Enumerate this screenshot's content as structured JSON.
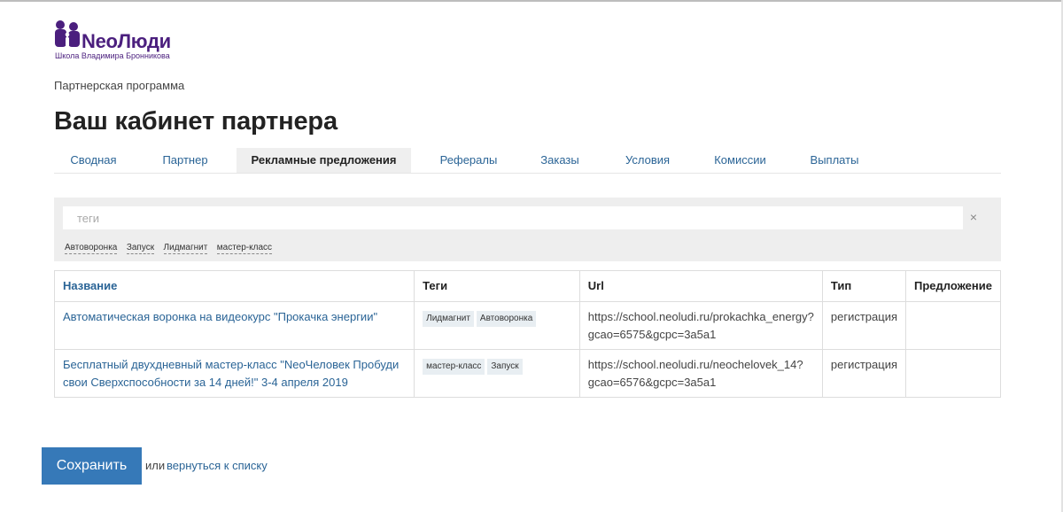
{
  "logo": {
    "brand": "NeoЛюди",
    "subtitle": "Школа Владимира Бронникова",
    "color": "#4b1f7e"
  },
  "breadcrumb": "Партнерская программа",
  "page_title": "Ваш кабинет партнера",
  "tabs": [
    {
      "label": "Сводная",
      "active": false
    },
    {
      "label": "Партнер",
      "active": false
    },
    {
      "label": "Рекламные предложения",
      "active": true
    },
    {
      "label": "Рефералы",
      "active": false
    },
    {
      "label": "Заказы",
      "active": false
    },
    {
      "label": "Условия",
      "active": false
    },
    {
      "label": "Комиссии",
      "active": false
    },
    {
      "label": "Выплаты",
      "active": false
    }
  ],
  "filter": {
    "placeholder": "теги",
    "value": "",
    "clear_icon": "×",
    "tags": [
      "Автоворонка",
      "Запуск",
      "Лидмагнит",
      "мастер-класс"
    ]
  },
  "table": {
    "headers": {
      "name": "Название",
      "tags": "Теги",
      "url": "Url",
      "type": "Тип",
      "offer": "Предложение"
    },
    "rows": [
      {
        "name": "Автоматическая воронка на видеокурс \"Прокачка энергии\"",
        "tags": [
          "Лидмагнит",
          "Автоворонка"
        ],
        "url_line1": "https://school.neoludi.ru/prokachka_energy?",
        "url_line2": "gcao=6575&gcpc=3a5a1",
        "type": "регистрация",
        "offer": ""
      },
      {
        "name": "Бесплатный двухдневный мастер-класс \"NeoЧеловек Пробуди свои Сверхспособности за 14 дней!\" 3-4 апреля 2019",
        "tags": [
          "мастер-класс",
          "Запуск"
        ],
        "url_line1": "https://school.neoludi.ru/neochelovek_14?",
        "url_line2": "gcao=6576&gcpc=3a5a1",
        "type": "регистрация",
        "offer": ""
      }
    ]
  },
  "actions": {
    "save_label": "Сохранить",
    "or_text": "или",
    "back_link": "вернуться к списку"
  },
  "colors": {
    "accent": "#3679b8",
    "link": "#2a6496"
  }
}
